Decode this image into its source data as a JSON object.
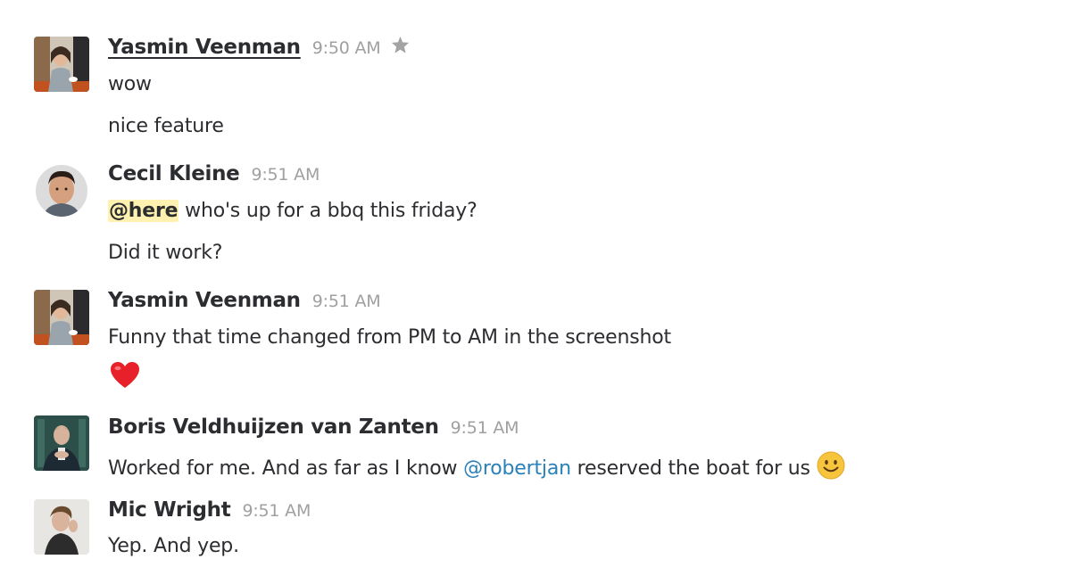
{
  "messages": [
    {
      "author": "Yasmin Veenman",
      "time": "9:50 AM",
      "starred": true,
      "avatar": "avatar-yasmin",
      "lines": [
        "wow",
        "nice feature"
      ]
    },
    {
      "author": "Cecil Kleine",
      "time": "9:51 AM",
      "avatar": "avatar-cecil",
      "line1_mention": "@here",
      "line1_rest": " who's up for a bbq this friday?",
      "line2": "Did it work?"
    },
    {
      "author": "Yasmin Veenman",
      "time": "9:51 AM",
      "avatar": "avatar-yasmin",
      "line1": "Funny that time changed from PM to AM in the screenshot",
      "line2_emoji": "heart-emoji"
    },
    {
      "author": "Boris Veldhuijzen van Zanten",
      "time": "9:51 AM",
      "avatar": "avatar-boris",
      "line1_before": "Worked for me. And as far as I know ",
      "line1_mention": "@robertjan",
      "line1_after": " reserved the boat for us ",
      "line1_emoji": "smiley-emoji"
    },
    {
      "author": "Mic Wright",
      "time": "9:51 AM",
      "avatar": "avatar-mic",
      "line1": "Yep. And yep."
    }
  ],
  "colors": {
    "author": "#2c2d30",
    "timestamp": "#a0a0a2",
    "mention_user": "#2a80b9",
    "mention_here_bg": "#fff2b0",
    "heart": "#e8202a",
    "smiley": "#f7c53d"
  },
  "icons": {
    "star": "star-icon"
  }
}
